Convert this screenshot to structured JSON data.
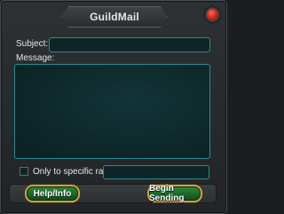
{
  "window": {
    "title": "GuildMail"
  },
  "form": {
    "subject_label": "Subject:",
    "subject_value": "",
    "message_label": "Message:",
    "message_value": "",
    "rank_checkbox_label": "Only to specific rank:",
    "rank_checked": false,
    "rank_value": ""
  },
  "buttons": {
    "help_label": "Help/Info",
    "send_label": "Begin Sending"
  },
  "colors": {
    "accent_field_border": "#2c8a91",
    "button_green": "#1e6a2a",
    "button_gold_border": "#c9a647",
    "close_red": "#d42a1e"
  }
}
